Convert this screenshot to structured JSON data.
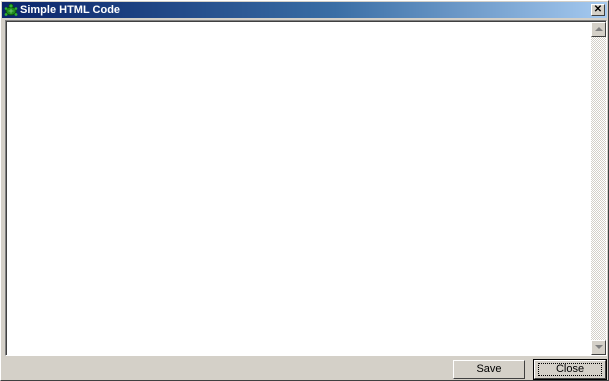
{
  "window": {
    "title": "Simple HTML Code",
    "icon": "turtle-app-icon",
    "close_glyph": "✕",
    "title_gradient": [
      "#0a246a",
      "#a6caf0"
    ]
  },
  "editor": {
    "value": "",
    "placeholder": ""
  },
  "buttons": {
    "save_label": "Save",
    "close_label": "Close"
  }
}
